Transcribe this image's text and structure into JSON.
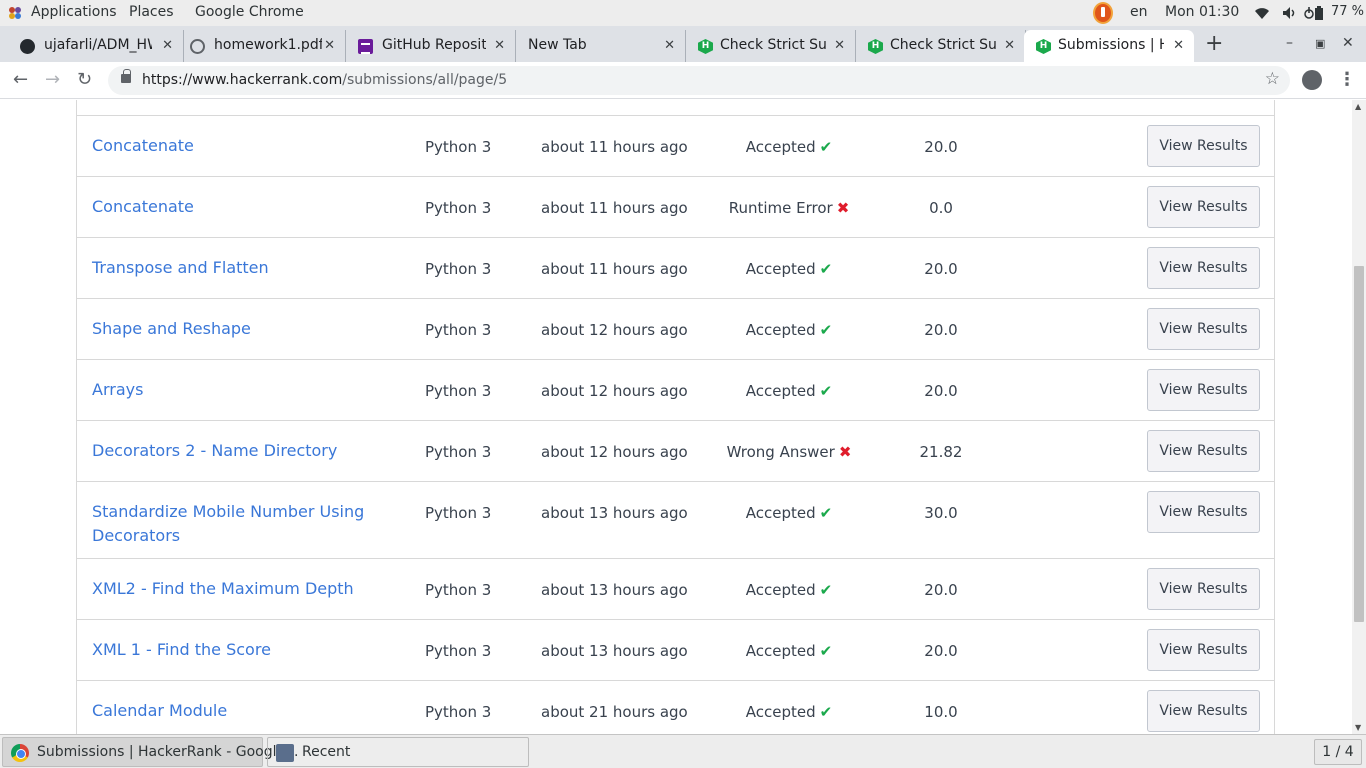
{
  "topbar": {
    "applications": "Applications",
    "places": "Places",
    "app_name": "Google Chrome",
    "lang": "en",
    "clock": "Mon 01:30",
    "battery": "77 %"
  },
  "tabs": [
    {
      "title": "ujafarli/ADM_HW",
      "favicon": "github-icon"
    },
    {
      "title": "homework1.pdf",
      "favicon": "globe-icon"
    },
    {
      "title": "GitHub Repository",
      "favicon": "forms-icon"
    },
    {
      "title": "New Tab",
      "favicon": ""
    },
    {
      "title": "Check Strict Superset",
      "favicon": "hackerrank-icon"
    },
    {
      "title": "Check Strict Superset",
      "favicon": "hackerrank-icon"
    },
    {
      "title": "Submissions | HackerRank",
      "favicon": "hackerrank-icon",
      "active": true
    }
  ],
  "address": {
    "scheme_host": "https://www.hackerrank.com",
    "path": "/submissions/all/page/5"
  },
  "submissions": [
    {
      "problem": "Concatenate",
      "language": "Python 3",
      "time": "about 11 hours ago",
      "status": "Accepted",
      "result": "ok",
      "score": "20.0",
      "action": "View Results"
    },
    {
      "problem": "Concatenate",
      "language": "Python 3",
      "time": "about 11 hours ago",
      "status": "Runtime Error",
      "result": "fail",
      "score": "0.0",
      "action": "View Results"
    },
    {
      "problem": "Transpose and Flatten",
      "language": "Python 3",
      "time": "about 11 hours ago",
      "status": "Accepted",
      "result": "ok",
      "score": "20.0",
      "action": "View Results"
    },
    {
      "problem": "Shape and Reshape",
      "language": "Python 3",
      "time": "about 12 hours ago",
      "status": "Accepted",
      "result": "ok",
      "score": "20.0",
      "action": "View Results"
    },
    {
      "problem": "Arrays",
      "language": "Python 3",
      "time": "about 12 hours ago",
      "status": "Accepted",
      "result": "ok",
      "score": "20.0",
      "action": "View Results"
    },
    {
      "problem": "Decorators 2 - Name Directory",
      "language": "Python 3",
      "time": "about 12 hours ago",
      "status": "Wrong Answer",
      "result": "fail",
      "score": "21.82",
      "action": "View Results"
    },
    {
      "problem": "Standardize Mobile Number Using Decorators",
      "language": "Python 3",
      "time": "about 13 hours ago",
      "status": "Accepted",
      "result": "ok",
      "score": "30.0",
      "action": "View Results"
    },
    {
      "problem": "XML2 - Find the Maximum Depth",
      "language": "Python 3",
      "time": "about 13 hours ago",
      "status": "Accepted",
      "result": "ok",
      "score": "20.0",
      "action": "View Results"
    },
    {
      "problem": "XML 1 - Find the Score",
      "language": "Python 3",
      "time": "about 13 hours ago",
      "status": "Accepted",
      "result": "ok",
      "score": "20.0",
      "action": "View Results"
    },
    {
      "problem": "Calendar Module",
      "language": "Python 3",
      "time": "about 21 hours ago",
      "status": "Accepted",
      "result": "ok",
      "score": "10.0",
      "action": "View Results"
    }
  ],
  "taskbar": {
    "window": "Submissions | HackerRank - Google...",
    "recent": "Recent",
    "workspace": "1 / 4"
  },
  "colors": {
    "link": "#3a77d8",
    "accepted": "#1ba94c",
    "error": "#e01d2c"
  }
}
